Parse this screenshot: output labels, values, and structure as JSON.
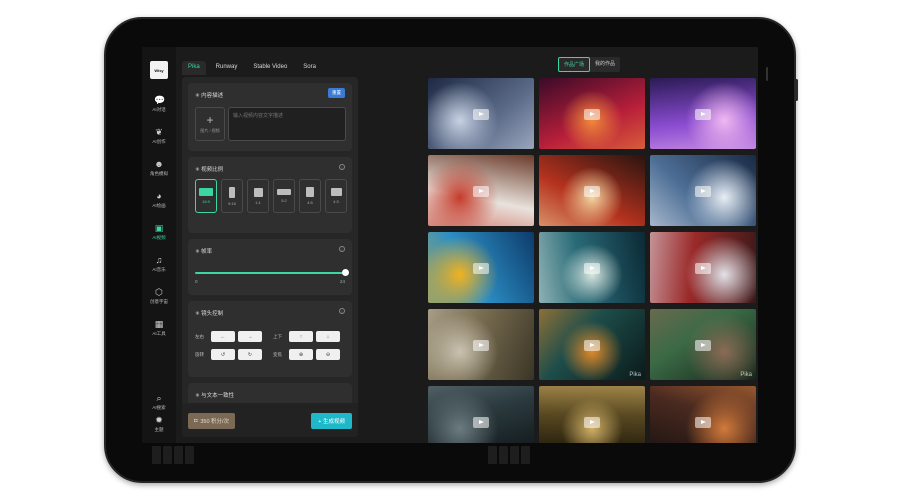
{
  "app": {
    "logo_text": "Wisy"
  },
  "sidebar": {
    "items": [
      {
        "label": "AI对话",
        "icon": "chat-icon"
      },
      {
        "label": "AI创作",
        "icon": "leaf-icon"
      },
      {
        "label": "角色模拟",
        "icon": "person-icon"
      },
      {
        "label": "AI绘画",
        "icon": "palette-icon"
      },
      {
        "label": "AI视频",
        "icon": "video-icon",
        "active": true
      },
      {
        "label": "AI音乐",
        "icon": "music-icon"
      },
      {
        "label": "创意宇宙",
        "icon": "cube-icon"
      },
      {
        "label": "AI工具",
        "icon": "grid-icon"
      }
    ],
    "bottom": [
      {
        "label": "AI搜索",
        "icon": "search-icon"
      },
      {
        "label": "主题",
        "icon": "sun-icon"
      }
    ]
  },
  "model_tabs": [
    "Pika",
    "Runway",
    "Stable Video",
    "Sora"
  ],
  "active_model": "Pika",
  "content": {
    "title": "内容描述",
    "clear_label": "重置",
    "upload_label": "图片 / 视频",
    "placeholder": "输入视频内容文字描述"
  },
  "aspect": {
    "title": "视频比例",
    "options": [
      "16:9",
      "9:16",
      "1:1",
      "5:2",
      "4:5",
      "4:3"
    ],
    "selected": "16:9"
  },
  "fps": {
    "title": "帧率",
    "min": "0",
    "max": "24",
    "value_fraction": 1.0
  },
  "camera": {
    "title": "镜头控制",
    "rows": [
      {
        "label": "左右",
        "buttons": [
          "←",
          "→"
        ]
      },
      {
        "label": "上下",
        "buttons": [
          "↑",
          "↓"
        ]
      },
      {
        "label": "旋转",
        "buttons": [
          "↺",
          "↻"
        ]
      },
      {
        "label": "变焦",
        "buttons": [
          "⊕",
          "⊖"
        ]
      }
    ]
  },
  "consistency": {
    "title": "与文本一致性"
  },
  "footer": {
    "credits": "350 积分/次",
    "generate": "+ 生成视频"
  },
  "gallery": {
    "tabs": [
      "作品广场",
      "我的作品"
    ],
    "active_tab": "作品广场",
    "watermark": "Pika",
    "items": [
      {
        "name": "robot-in-snow",
        "colors": [
          "#1e2a44",
          "#5b6a88",
          "#c7d2e4"
        ]
      },
      {
        "name": "dragon-lanterns",
        "colors": [
          "#3b0a28",
          "#b81f3a",
          "#f08a3a"
        ]
      },
      {
        "name": "purple-fantasy-village",
        "colors": [
          "#2a1b55",
          "#8a4bd0",
          "#f0b8f0"
        ]
      },
      {
        "name": "winter-room",
        "colors": [
          "#6b3b2a",
          "#e8e2dc",
          "#c53b2a"
        ]
      },
      {
        "name": "chinese-pavilion",
        "colors": [
          "#2a1410",
          "#b5321e",
          "#f3d6a0"
        ]
      },
      {
        "name": "polar-bear",
        "colors": [
          "#1a2a45",
          "#4d6e95",
          "#e8eef5"
        ]
      },
      {
        "name": "coral-reef-bird",
        "colors": [
          "#0d3b6b",
          "#2c8fc5",
          "#f2b21e"
        ]
      },
      {
        "name": "ocean-sailboat",
        "colors": [
          "#0b2a35",
          "#2a6b78",
          "#d8e6e0"
        ]
      },
      {
        "name": "snowy-palace",
        "colors": [
          "#3a1818",
          "#9b2a2a",
          "#e2e2e8"
        ]
      },
      {
        "name": "wolf-on-rocks",
        "colors": [
          "#3a3525",
          "#7a6e52",
          "#c9c2b0"
        ]
      },
      {
        "name": "cyber-frog",
        "colors": [
          "#0a1a1a",
          "#1d4d4a",
          "#e08a2a"
        ]
      },
      {
        "name": "woman-forest",
        "colors": [
          "#15251a",
          "#3b6a45",
          "#8a6b55"
        ]
      },
      {
        "name": "dark-forest-figure",
        "colors": [
          "#0f1518",
          "#2b3a3e",
          "#6b7b80"
        ]
      },
      {
        "name": "library-shelves",
        "colors": [
          "#1a1508",
          "#5a4a22",
          "#d1b066"
        ]
      },
      {
        "name": "fantasy-town",
        "colors": [
          "#1a1210",
          "#4a2a20",
          "#d27a3a"
        ]
      }
    ]
  }
}
